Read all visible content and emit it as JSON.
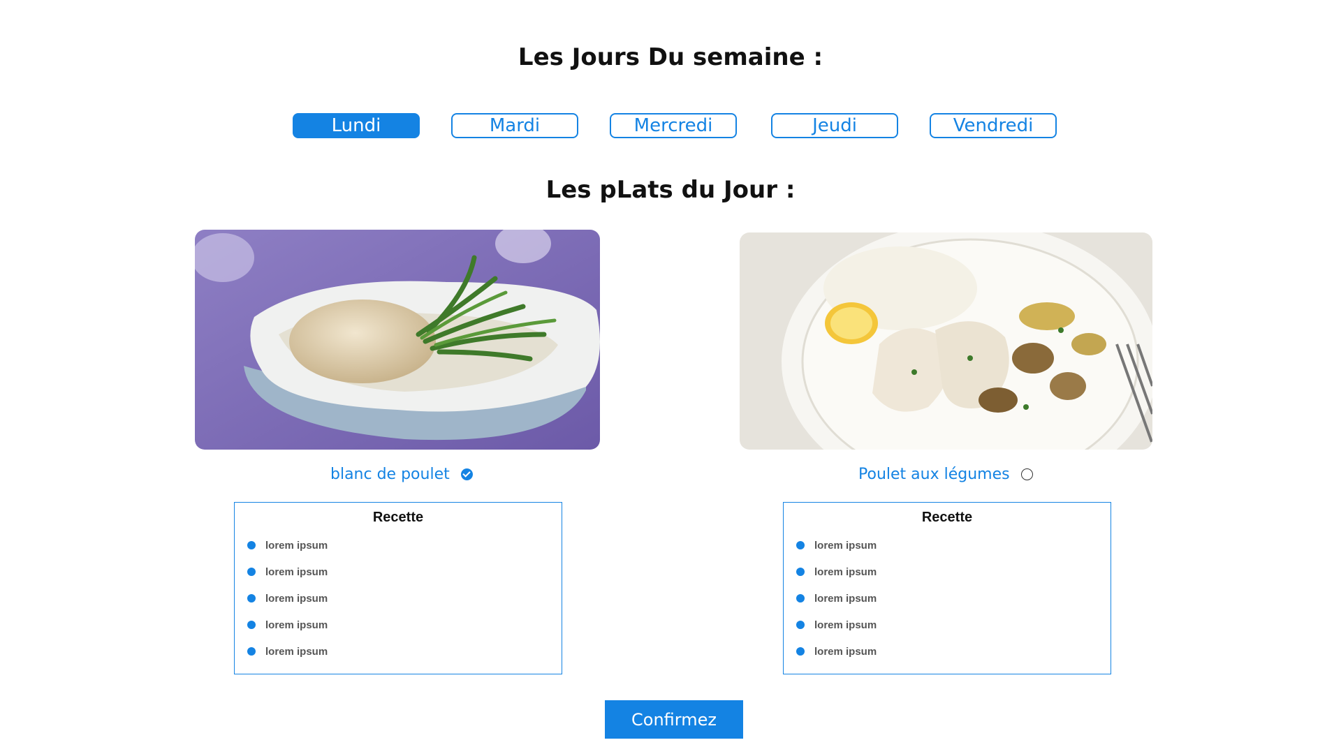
{
  "days_section": {
    "heading": "Les Jours Du semaine :",
    "days": [
      {
        "label": "Lundi",
        "active": true
      },
      {
        "label": "Mardi",
        "active": false
      },
      {
        "label": "Mercredi",
        "active": false
      },
      {
        "label": "Jeudi",
        "active": false
      },
      {
        "label": "Vendredi",
        "active": false
      }
    ]
  },
  "dishes_section": {
    "heading": "Les pLats du Jour :",
    "dishes": [
      {
        "name": "blanc de poulet",
        "selected": true,
        "photo_icon": "chicken-breast-with-green-beans-photo",
        "recipe": {
          "title": "Recette",
          "items": [
            "lorem ipsum",
            "lorem ipsum",
            "lorem ipsum",
            "lorem ipsum",
            "lorem ipsum"
          ]
        }
      },
      {
        "name": "Poulet aux légumes",
        "selected": false,
        "photo_icon": "chicken-with-rice-and-mushrooms-photo",
        "recipe": {
          "title": "Recette",
          "items": [
            "lorem ipsum",
            "lorem ipsum",
            "lorem ipsum",
            "lorem ipsum",
            "lorem ipsum"
          ]
        }
      }
    ]
  },
  "confirm_label": "Confirmez",
  "colors": {
    "accent": "#1483e3",
    "heading_text": "#111111",
    "list_text": "#555555"
  }
}
